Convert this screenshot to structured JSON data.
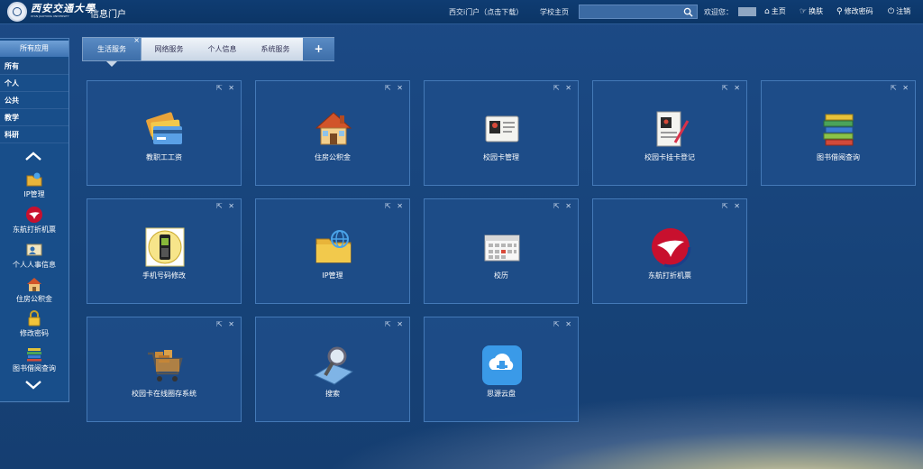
{
  "header": {
    "logo_cn": "西安交通大學",
    "logo_en": "XI'AN JIAOTONG UNIVERSITY",
    "app_title": "信息门户",
    "portal_link": "西交i门户（点击下载）",
    "school_home": "学校主页",
    "search_placeholder": "",
    "welcome": "欢迎您：",
    "nav": {
      "home": "主页",
      "skin": "换肤",
      "change_pwd": "修改密码",
      "logout": "注销"
    }
  },
  "sidebar": {
    "title": "所有应用",
    "categories": [
      "所有",
      "个人",
      "公共",
      "教学",
      "科研"
    ],
    "apps": [
      "IP管理",
      "东航打折机票",
      "个人人事信息",
      "住房公积金",
      "修改密码",
      "图书借阅查询"
    ]
  },
  "tabs": [
    "生活服务",
    "网络服务",
    "个人信息",
    "系统服务"
  ],
  "tab_add": "+",
  "tiles": [
    {
      "label": "教职工工资",
      "icon": "credit-cards-icon"
    },
    {
      "label": "住房公积金",
      "icon": "house-icon"
    },
    {
      "label": "校园卡管理",
      "icon": "id-card-icon"
    },
    {
      "label": "校园卡挂卡登记",
      "icon": "card-register-icon"
    },
    {
      "label": "图书借阅查询",
      "icon": "books-icon"
    },
    {
      "label": "手机号码修改",
      "icon": "mobile-phone-icon"
    },
    {
      "label": "IP管理",
      "icon": "folder-network-icon"
    },
    {
      "label": "校历",
      "icon": "calendar-icon"
    },
    {
      "label": "东航打折机票",
      "icon": "china-eastern-icon"
    },
    {
      "label": "校园卡在线圈存系统",
      "icon": "shopping-cart-icon"
    },
    {
      "label": "搜索",
      "icon": "search-pin-icon"
    },
    {
      "label": "思源云盘",
      "icon": "cloud-drive-icon"
    }
  ],
  "colors": {
    "accent": "#3d6ea9",
    "tile_bg": "#1e4e8a",
    "header_bg": "#0f3c72"
  }
}
